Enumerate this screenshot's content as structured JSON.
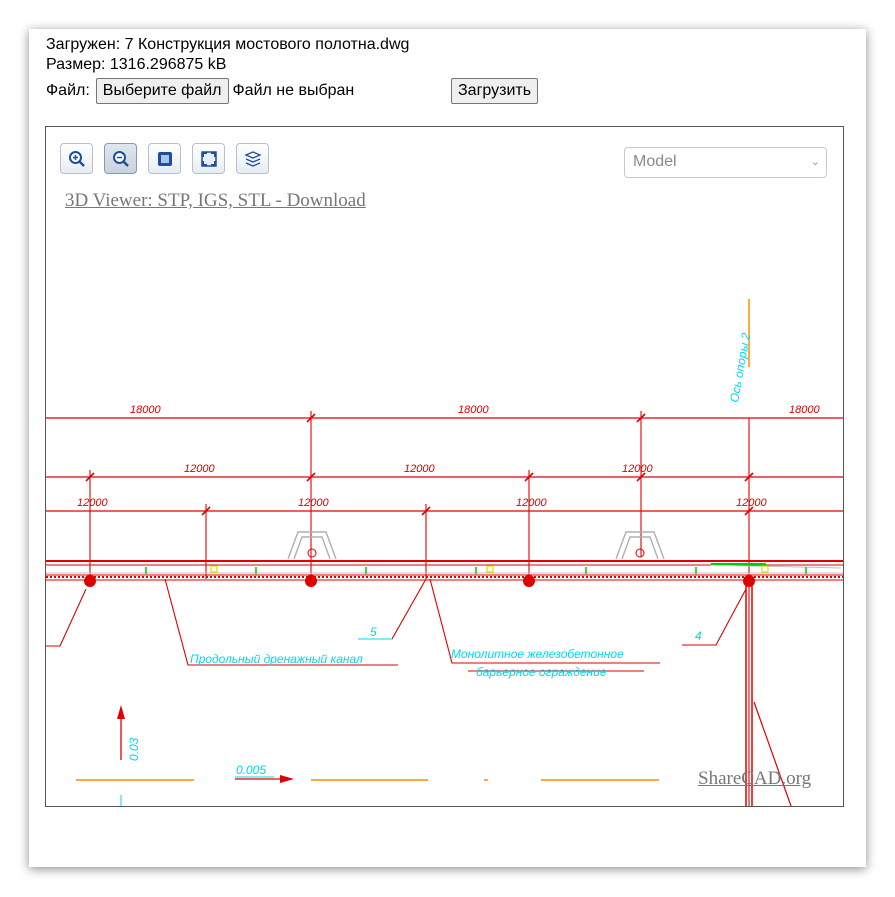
{
  "info": {
    "loaded": "Загружен: 7 Конструкция мостового полотна.dwg",
    "size": "Размер: 1316.296875 kB"
  },
  "file_input": {
    "label": "Файл:",
    "choose_label": "Выберите файл",
    "status": "Файл не выбран",
    "upload_label": "Загрузить"
  },
  "viewer": {
    "toolbar": [
      {
        "icon": "zoom-in-icon"
      },
      {
        "icon": "zoom-out-icon"
      },
      {
        "icon": "fit-icon"
      },
      {
        "icon": "fullscreen-icon"
      },
      {
        "icon": "layers-icon"
      }
    ],
    "layout_select": "Model",
    "link_3d": "3D Viewer: STP, IGS, STL - Download",
    "watermark": "ShareCAD.org"
  },
  "drawing": {
    "dims_top": [
      "18000",
      "18000",
      "18000"
    ],
    "dims_mid": [
      "12000",
      "12000",
      "12000"
    ],
    "dims_low": [
      "12000",
      "12000",
      "12000",
      "12000"
    ],
    "axis_label": "Ось опоры 2",
    "callout_5": "5",
    "callout_4": "4",
    "drain_label": "Продольный дренажный канал",
    "barrier_label_1": "Монолитное железобетонное",
    "barrier_label_2": "барьерное ограждение",
    "slope_vertical": "0.03",
    "slope_horizontal": "0.005",
    "colors": {
      "dimension": "#e00000",
      "annotation": "#00d8f0",
      "axis": "#ff8c00",
      "marker": "#00cc00"
    }
  }
}
